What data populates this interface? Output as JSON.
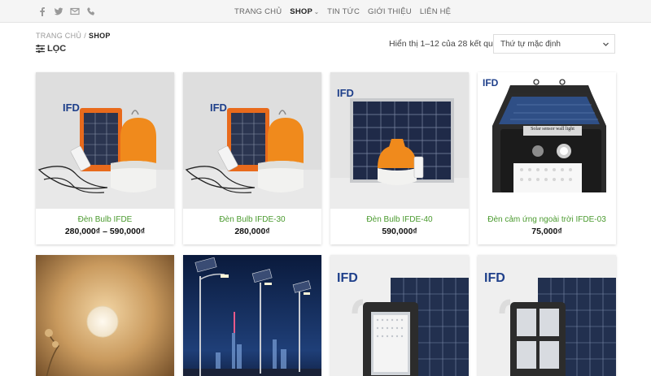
{
  "topbar": {
    "social_icons": [
      "facebook-icon",
      "twitter-icon",
      "email-icon",
      "phone-icon"
    ],
    "nav": [
      {
        "label": "TRANG CHỦ"
      },
      {
        "label": "SHOP",
        "active": true,
        "has_dropdown": true
      },
      {
        "label": "TIN TỨC"
      },
      {
        "label": "GIỚI THIỆU"
      },
      {
        "label": "LIÊN HỆ"
      }
    ]
  },
  "breadcrumb": {
    "home": "TRANG CHỦ",
    "separator": "/",
    "current": "SHOP"
  },
  "filter_label": "LỌC",
  "result_count": "Hiển thị 1–12 của 28 kết quả",
  "sort": {
    "selected": "Thứ tự mặc định"
  },
  "logo_text": "IFD",
  "products": [
    {
      "name": "Đèn Bulb IFDE",
      "price": "280,000₫ – 590,000₫"
    },
    {
      "name": "Đèn Bulb IFDE-30",
      "price": "280,000₫"
    },
    {
      "name": "Đèn Bulb IFDE-40",
      "price": "590,000₫"
    },
    {
      "name": "Đèn cảm ứng ngoài trời IFDE-03",
      "price": "75,000₫"
    },
    {
      "name": "",
      "price": ""
    },
    {
      "name": "",
      "price": ""
    },
    {
      "name": "",
      "price": ""
    },
    {
      "name": "",
      "price": ""
    }
  ],
  "product4_label": "Solar sensor wall light",
  "colors": {
    "accent_green": "#4a9a2e",
    "bulb_orange": "#f08a1c",
    "panel_blue": "#2f4f86"
  }
}
